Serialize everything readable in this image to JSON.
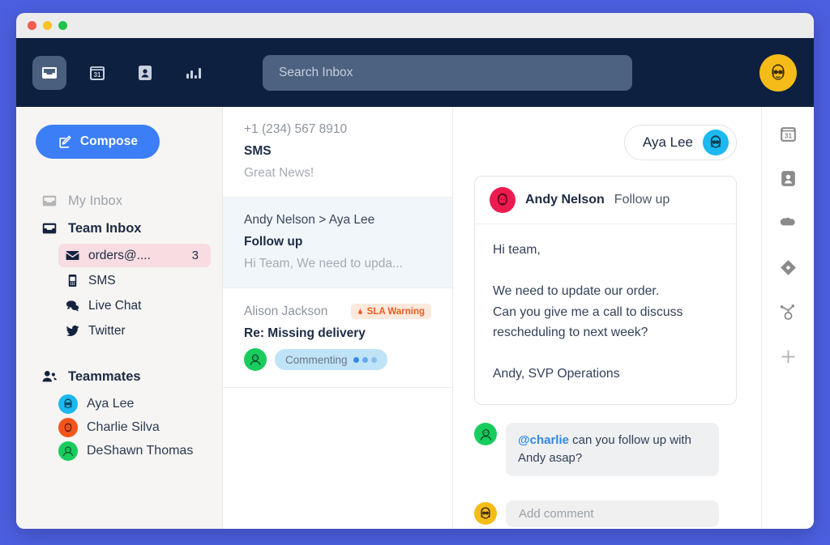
{
  "window": {
    "traffic_lights": [
      "close",
      "minimize",
      "maximize"
    ]
  },
  "topnav": {
    "icons": [
      {
        "name": "inbox-icon",
        "label": "Inbox",
        "active": true
      },
      {
        "name": "calendar-icon",
        "label": "Calendar",
        "day": "31"
      },
      {
        "name": "contact-icon",
        "label": "Contacts"
      },
      {
        "name": "reports-icon",
        "label": "Reports"
      }
    ],
    "search": {
      "placeholder": "Search Inbox",
      "value": ""
    },
    "avatar": {
      "name": "user-avatar",
      "color": "#f5bb18"
    }
  },
  "sidebar": {
    "compose_label": "Compose",
    "nav": [
      {
        "label": "My Inbox",
        "icon": "inbox-outline-icon",
        "state": "muted"
      },
      {
        "label": "Team Inbox",
        "icon": "inbox-filled-icon",
        "state": "active"
      }
    ],
    "channels": [
      {
        "label": "orders@....",
        "icon": "envelope-icon",
        "count": "3",
        "highlighted": true
      },
      {
        "label": "SMS",
        "icon": "phone-icon",
        "count": "",
        "highlighted": false
      },
      {
        "label": "Live Chat",
        "icon": "chat-icon",
        "count": "",
        "highlighted": false
      },
      {
        "label": "Twitter",
        "icon": "twitter-icon",
        "count": "",
        "highlighted": false
      }
    ],
    "teammates_label": "Teammates",
    "teammates": [
      {
        "name": "Aya Lee",
        "color": "#1cb8ef"
      },
      {
        "name": "Charlie Silva",
        "color": "#f4551d"
      },
      {
        "name": "DeShawn Thomas",
        "color": "#19cc5e"
      }
    ]
  },
  "conversations": [
    {
      "from": "+1 (234) 567 8910",
      "subject": "SMS",
      "preview": "Great News!",
      "selected": false,
      "badge": null,
      "status": null
    },
    {
      "from": "Andy Nelson > Aya Lee",
      "subject": "Follow up",
      "preview": "Hi Team, We need to upda...",
      "selected": true,
      "badge": null,
      "status": null
    },
    {
      "from": "Alison Jackson",
      "subject": "Re: Missing delivery",
      "preview": "",
      "selected": false,
      "badge": {
        "label": "SLA Warning",
        "icon": "flame-icon",
        "color": "#f05a22",
        "bg": "#fde9dc"
      },
      "status": {
        "label": "Commenting",
        "avatar_color": "#19cc5e"
      }
    }
  ],
  "detail": {
    "assignee": {
      "name": "Aya Lee",
      "avatar_color": "#1cb8ef"
    },
    "message": {
      "sender": "Andy Nelson",
      "sender_avatar_color": "#ec1b50",
      "subject": "Follow up",
      "body": "Hi team,\n\nWe need to update our order.\nCan you give me a call to discuss\nrescheduling to next week?\n\nAndy, SVP Operations"
    },
    "comment": {
      "avatar_color": "#19cc5e",
      "mention": "@charlie",
      "text": " can you follow up with Andy asap?"
    },
    "add_comment": {
      "avatar_color": "#f5bb18",
      "placeholder": "Add comment"
    }
  },
  "rightrail": {
    "icons": [
      {
        "name": "calendar-icon",
        "day": "31"
      },
      {
        "name": "contact-icon"
      },
      {
        "name": "salesforce-cloud-icon"
      },
      {
        "name": "diamond-icon"
      },
      {
        "name": "hubspot-icon"
      },
      {
        "name": "add-app-icon",
        "label": "+"
      }
    ]
  }
}
